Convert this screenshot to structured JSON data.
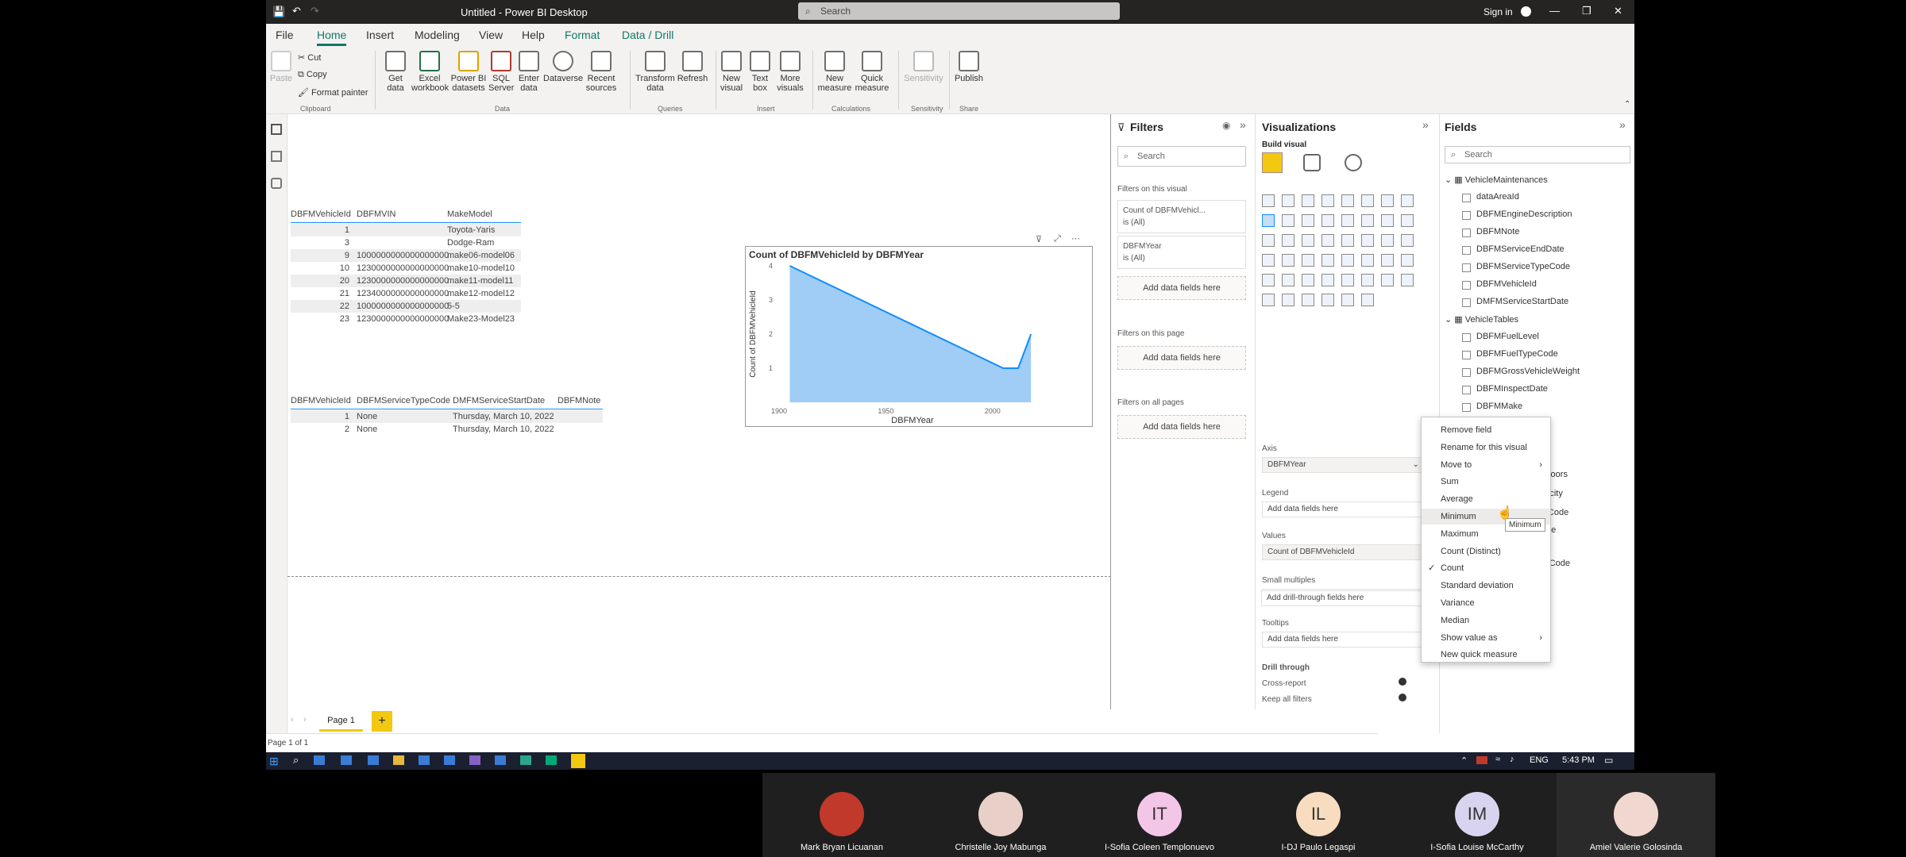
{
  "window": {
    "title": "Untitled - Power BI Desktop",
    "search_placeholder": "Search",
    "signin": "Sign in",
    "minimize": "—",
    "restore": "❐",
    "close": "✕"
  },
  "ribbon_tabs": [
    "File",
    "Home",
    "Insert",
    "Modeling",
    "View",
    "Help",
    "Format",
    "Data / Drill"
  ],
  "ribbon": {
    "clipboard": {
      "paste": "Paste",
      "cut": "Cut",
      "copy": "Copy",
      "format_painter": "Format painter",
      "group": "Clipboard"
    },
    "data": {
      "get_data": "Get data",
      "excel": "Excel workbook",
      "pbi_datasets": "Power BI datasets",
      "sql": "SQL Server",
      "enter": "Enter data",
      "dataverse": "Dataverse",
      "recent": "Recent sources",
      "group": "Data"
    },
    "queries": {
      "transform": "Transform data",
      "refresh": "Refresh",
      "group": "Queries"
    },
    "insert": {
      "new_visual": "New visual",
      "text_box": "Text box",
      "more": "More visuals",
      "group": "Insert"
    },
    "calc": {
      "new_measure": "New measure",
      "quick_measure": "Quick measure",
      "group": "Calculations"
    },
    "sensitivity": {
      "label": "Sensitivity",
      "group": "Sensitivity"
    },
    "share": {
      "publish": "Publish",
      "group": "Share"
    }
  },
  "table1": {
    "headers": [
      "DBFMVehicleId",
      "DBFMVIN",
      "MakeModel"
    ],
    "rows": [
      [
        "1",
        "",
        "Toyota-Yaris"
      ],
      [
        "3",
        "",
        "Dodge-Ram"
      ],
      [
        "9",
        "1000000000000000000",
        "make06-model06"
      ],
      [
        "10",
        "1230000000000000000",
        "make10-model10"
      ],
      [
        "20",
        "1230000000000000000",
        "make11-model11"
      ],
      [
        "21",
        "1234000000000000000",
        "make12-model12"
      ],
      [
        "22",
        "1000000000000000000",
        "5-5"
      ],
      [
        "23",
        "1230000000000000000",
        "Make23-Model23"
      ]
    ]
  },
  "table2": {
    "headers": [
      "DBFMVehicleId",
      "DBFMServiceTypeCode",
      "DMFMServiceStartDate",
      "DBFMNote"
    ],
    "rows": [
      [
        "1",
        "None",
        "Thursday, March 10, 2022",
        ""
      ],
      [
        "2",
        "None",
        "Thursday, March 10, 2022",
        ""
      ]
    ]
  },
  "chart_data": {
    "type": "area",
    "title": "Count of DBFMVehicleId by DBFMYear",
    "xlabel": "DBFMYear",
    "ylabel": "Count of DBFMVehicleId",
    "x": [
      1905,
      2005,
      2012,
      2018
    ],
    "y": [
      4,
      1,
      1,
      2
    ],
    "xlim": [
      1900,
      2025
    ],
    "ylim": [
      1,
      4
    ],
    "xticks": [
      "1900",
      "1950",
      "2000"
    ],
    "yticks": [
      "4",
      "3",
      "2",
      "1"
    ],
    "color": "#118dff",
    "fill": "#a0cdf6"
  },
  "pages": {
    "current": "Page 1",
    "status": "Page 1 of 1",
    "add": "+"
  },
  "filters": {
    "title": "Filters",
    "search": "Search",
    "on_visual": "Filters on this visual",
    "card1": {
      "name": "Count of DBFMVehicl...",
      "value": "is (All)"
    },
    "card2": {
      "name": "DBFMYear",
      "value": "is (All)"
    },
    "add": "Add data fields here",
    "on_page": "Filters on this page",
    "on_all": "Filters on all pages"
  },
  "visualizations": {
    "title": "Visualizations",
    "build": "Build visual",
    "axis": "Axis",
    "axis_value": "DBFMYear",
    "legend": "Legend",
    "values": "Values",
    "values_value": "Count of DBFMVehicleId",
    "small_multiples": "Small multiples",
    "tooltips": "Tooltips",
    "drill": "Drill through",
    "cross_report": "Cross-report",
    "keep_filters": "Keep all filters",
    "add": "Add data fields here",
    "add_drill": "Add drill-through fields here"
  },
  "fields": {
    "title": "Fields",
    "search": "Search",
    "tables": [
      {
        "name": "VehicleMaintenances",
        "items": [
          "dataAreaId",
          "DBFMEngineDescription",
          "DBFMNote",
          "DBFMServiceEndDate",
          "DBFMServiceTypeCode",
          "DBFMVehicleId",
          "DMFMServiceStartDate"
        ]
      },
      {
        "name": "VehicleTables",
        "items": [
          "DBFMFuelLevel",
          "DBFMFuelTypeCode",
          "DBFMGrossVehicleWeight",
          "DBFMInspectDate",
          "DBFMMake"
        ]
      }
    ],
    "partial": [
      "OfDoors",
      "apacity",
      "rpeCode",
      "Code",
      "ypeCode"
    ]
  },
  "context_menu": [
    "Remove field",
    "Rename for this visual",
    "Move to",
    "Sum",
    "Average",
    "Minimum",
    "Maximum",
    "Count (Distinct)",
    "Count",
    "Standard deviation",
    "Variance",
    "Median",
    "Show value as",
    "New quick measure"
  ],
  "tooltip": "Minimum",
  "taskbar": {
    "lang": "ENG",
    "time": "5:43 PM"
  },
  "participants": [
    {
      "name": "Mark Bryan Licuanan",
      "initials": "",
      "color": "#c0392b"
    },
    {
      "name": "Christelle Joy Mabunga",
      "initials": "",
      "color": "#e8d0c8"
    },
    {
      "name": "I-Sofia Coleen Templonuevo",
      "initials": "IT",
      "color": "#f3c6e8"
    },
    {
      "name": "I-DJ Paulo Legaspi",
      "initials": "IL",
      "color": "#f8dcc0"
    },
    {
      "name": "I-Sofia Louise McCarthy",
      "initials": "IM",
      "color": "#d8d4f0"
    },
    {
      "name": "Amiel Valerie Golosinda",
      "initials": "",
      "color": "#f0d8d0"
    }
  ]
}
